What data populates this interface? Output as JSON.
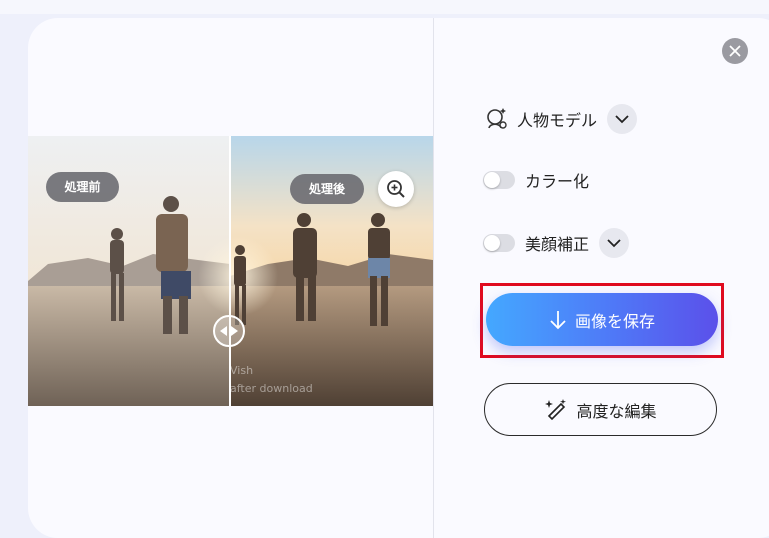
{
  "preview": {
    "before_label": "処理前",
    "after_label": "処理後",
    "watermark_line1": "Vish",
    "watermark_line2": "after download"
  },
  "options": {
    "model_label": "人物モデル",
    "colorize_label": "カラー化",
    "colorize_enabled": false,
    "beauty_label": "美顔補正",
    "beauty_enabled": false
  },
  "actions": {
    "save_label": "画像を保存",
    "advanced_edit_label": "高度な編集"
  },
  "icons": {
    "close": "close-icon",
    "zoom": "zoom-in-icon",
    "model": "person-model-icon",
    "chevron": "chevron-down-icon",
    "save": "download-arrow-icon",
    "edit": "magic-wand-icon"
  },
  "colors": {
    "save_gradient_start": "#44a8ff",
    "save_gradient_end": "#5b50ea",
    "highlight": "#e00b1f"
  }
}
